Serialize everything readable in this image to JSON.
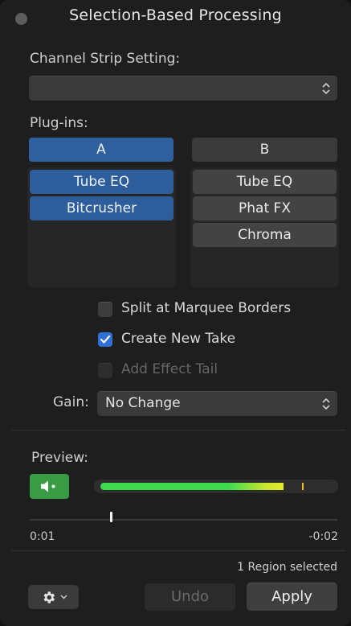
{
  "window": {
    "title": "Selection-Based Processing"
  },
  "channel_strip": {
    "label": "Channel Strip Setting:",
    "value": ""
  },
  "plugins": {
    "label": "Plug-ins:",
    "column_a": {
      "header": "A",
      "items": [
        "Tube EQ",
        "Bitcrusher"
      ]
    },
    "column_b": {
      "header": "B",
      "items": [
        "Tube EQ",
        "Phat FX",
        "Chroma"
      ]
    }
  },
  "options": {
    "split": {
      "label": "Split at Marquee Borders",
      "checked": false
    },
    "create_take": {
      "label": "Create New Take",
      "checked": true
    },
    "effect_tail": {
      "label": "Add Effect Tail",
      "checked": false,
      "disabled": true
    }
  },
  "gain": {
    "label": "Gain:",
    "value": "No Change"
  },
  "preview": {
    "label": "Preview:",
    "meter_level": 0.79,
    "peak_hold": 0.87,
    "playhead_position": 0.26,
    "time_start": "0:01",
    "time_end": "-0:02"
  },
  "status": {
    "selection_text": "1 Region selected"
  },
  "buttons": {
    "undo": "Undo",
    "apply": "Apply"
  },
  "colors": {
    "accent_blue": "#2f5f9d",
    "preview_green": "#3a9b45",
    "checkbox_blue": "#2f6fd6"
  },
  "icons": {
    "close": "window-close-dot",
    "popup": "up-down-chevrons-icon",
    "speaker": "speaker-icon",
    "gear": "gear-icon",
    "checkmark": "checkmark-icon"
  }
}
